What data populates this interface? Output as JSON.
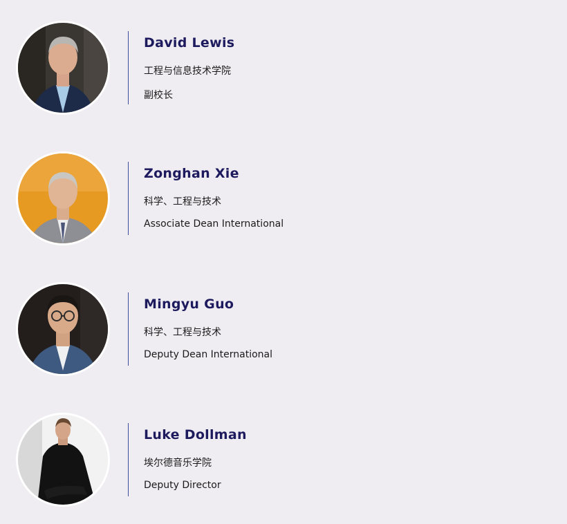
{
  "people": [
    {
      "name": "David Lewis",
      "department": "工程与信息技术学院",
      "role": "副校长"
    },
    {
      "name": "Zonghan Xie",
      "department": "科学、工程与技术",
      "role": "Associate Dean International"
    },
    {
      "name": "Mingyu Guo",
      "department": "科学、工程与技术",
      "role": "Deputy Dean International"
    },
    {
      "name": "Luke Dollman",
      "department": "埃尔德音乐学院",
      "role": "Deputy Director"
    }
  ],
  "colors": {
    "background": "#efedf2",
    "name_text": "#1e1a5e",
    "divider": "#3d4f9c",
    "body_text": "#1a1a1a"
  }
}
